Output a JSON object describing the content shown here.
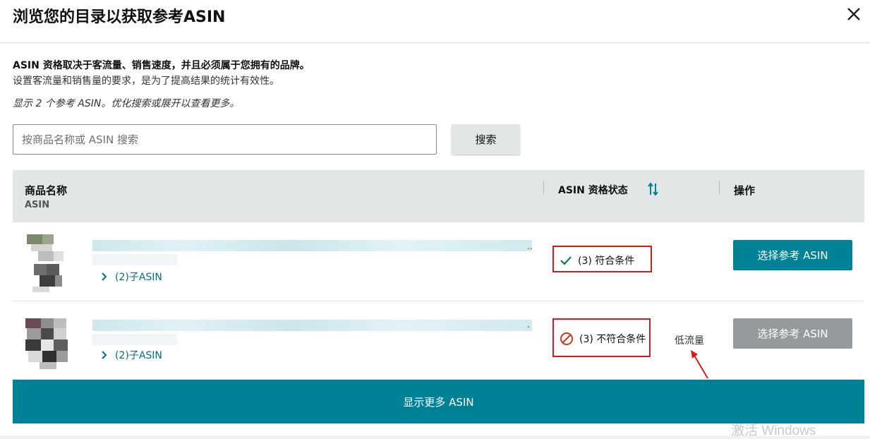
{
  "modal": {
    "title": "浏览您的目录以获取参考ASIN",
    "description_line1": "ASIN 资格取决于客流量、销售速度，并且必须属于您拥有的品牌。",
    "description_line2": "设置客流量和销售量的要求，是为了提高结果的统计有效性。",
    "result_note": "显示 2 个参考 ASIN。优化搜索或展开以查看更多。"
  },
  "search": {
    "placeholder": "按商品名称或 ASIN 搜索",
    "button_label": "搜索"
  },
  "table": {
    "columns": {
      "product_name": "商品名称",
      "asin": "ASIN",
      "status": "ASIN 资格状态",
      "action": "操作"
    },
    "rows": [
      {
        "child_asin_label": "(2)子ASIN",
        "status_text": "(3) 符合条件",
        "status_icon": "check-icon",
        "action_label": "选择参考 ASIN",
        "action_color": "#008296",
        "annotation": ""
      },
      {
        "child_asin_label": "(2)子ASIN",
        "status_text": "(3) 不符合条件",
        "status_icon": "prohibited-icon",
        "action_label": "选择参考 ASIN",
        "action_color": "#959a9c",
        "annotation": "低流量"
      }
    ]
  },
  "footer": {
    "show_more_label": "显示更多 ASIN"
  },
  "watermark": "激活 Windows",
  "colors": {
    "teal": "#008296",
    "link": "#007185",
    "highlight_border": "#e0171c",
    "disabled_button": "#959a9c",
    "check_green": "#067d62",
    "prohibited_red": "#cc3a1a"
  }
}
